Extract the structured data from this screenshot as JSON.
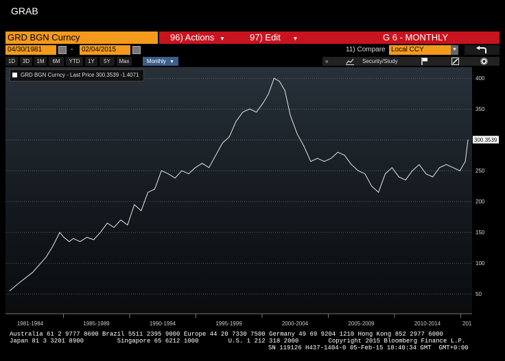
{
  "app": {
    "title": "GRAB"
  },
  "header": {
    "security": "GRD BGN Curncy",
    "actions_label": "96) Actions",
    "edit_label": "97) Edit",
    "view_title": "G 6 - MONTHLY",
    "start_date": "04/30/1981",
    "date_sep": "-",
    "end_date": "02/04/2015",
    "compare_label": "11) Compare",
    "compare_value": "Local CCY"
  },
  "tabs": [
    "1D",
    "3D",
    "1M",
    "6M",
    "YTD",
    "1Y",
    "5Y",
    "Max",
    "Monthly"
  ],
  "active_tab": "Monthly",
  "toolbar": {
    "collapse": "«",
    "security_study": "Security/Study"
  },
  "legend": {
    "text": "GRD BGN Curncy - Last Price 300.3539 -1.4071"
  },
  "colors": {
    "accent_orange": "#f39a1c",
    "header_red": "#c8141e",
    "line": "#e8e8e8",
    "active_tab": "#3a5f8c"
  },
  "chart_data": {
    "type": "line",
    "series": [
      {
        "name": "GRD BGN Curncy",
        "x": [
          1981.3,
          1982.0,
          1983.0,
          1984.0,
          1984.5,
          1985.0,
          1985.3,
          1985.7,
          1986.0,
          1986.5,
          1987.0,
          1987.5,
          1988.0,
          1988.5,
          1989.0,
          1989.5,
          1990.0,
          1990.5,
          1991.0,
          1991.5,
          1992.0,
          1992.5,
          1993.0,
          1993.5,
          1994.0,
          1994.5,
          1995.0,
          1995.5,
          1996.0,
          1996.5,
          1997.0,
          1997.5,
          1998.0,
          1998.5,
          1999.0,
          1999.5,
          2000.0,
          2000.4,
          2000.8,
          2001.2,
          2001.6,
          2002.0,
          2002.5,
          2003.0,
          2003.5,
          2004.0,
          2004.5,
          2005.0,
          2005.5,
          2006.0,
          2006.5,
          2007.0,
          2007.5,
          2008.0,
          2008.5,
          2009.0,
          2009.5,
          2010.0,
          2010.5,
          2011.0,
          2011.5,
          2012.0,
          2012.5,
          2013.0,
          2013.5,
          2014.0,
          2014.5,
          2014.9,
          2015.1
        ],
        "values": [
          55,
          68,
          85,
          110,
          128,
          150,
          142,
          135,
          140,
          135,
          142,
          138,
          150,
          165,
          158,
          170,
          162,
          195,
          185,
          215,
          220,
          250,
          245,
          238,
          250,
          245,
          255,
          262,
          255,
          275,
          295,
          305,
          330,
          345,
          350,
          345,
          360,
          375,
          400,
          395,
          380,
          340,
          310,
          290,
          265,
          270,
          265,
          270,
          280,
          275,
          260,
          250,
          245,
          225,
          215,
          245,
          255,
          240,
          235,
          250,
          260,
          245,
          240,
          255,
          260,
          255,
          250,
          265,
          300.3539
        ]
      }
    ],
    "title": "",
    "xlabel": "",
    "ylabel": "",
    "x_tick_labels": [
      "1981-1984",
      "1985-1989",
      "1990-1994",
      "1995-1999",
      "2000-2004",
      "2005-2009",
      "2010-2014",
      "201"
    ],
    "y_ticks": [
      50,
      100,
      150,
      200,
      250,
      300,
      350,
      400
    ],
    "ylim": [
      18,
      418
    ],
    "xlim": [
      1981.0,
      2015.4
    ],
    "last_value_label": "300.3539",
    "grid": true,
    "legend_position": "top-left"
  },
  "footer": {
    "line1": "Australia 61 2 9777 8600 Brazil 5511 2395 9000 Europe 44 20 7330 7500 Germany 49 69 9204 1210 Hong Kong 852 2977 6000",
    "line2": "Japan 81 3 3201 8900         Singapore 65 6212 1000        U.S. 1 212 318 2000        Copyright 2015 Bloomberg Finance L.P.",
    "line3": "SN 119126 H437-1404-0 05-Feb-15 18:40:34 GMT  GMT+0:00"
  }
}
